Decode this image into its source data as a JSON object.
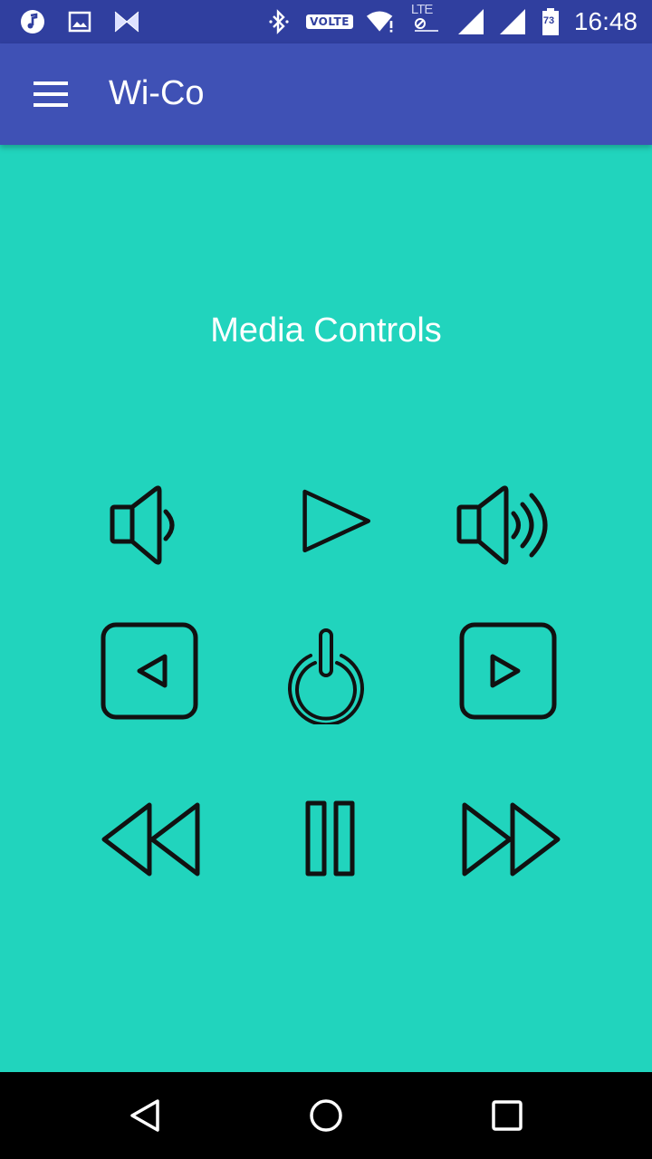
{
  "status_bar": {
    "left_icons": [
      "music-note-icon",
      "image-icon",
      "bowtie-icon"
    ],
    "right_icons": [
      "bluetooth-icon",
      "wifi-icon",
      "lte-icon",
      "signal-icon",
      "signal-icon",
      "battery-icon"
    ],
    "volte": "VOLTE",
    "lte": "LTE",
    "battery_level": "73",
    "time": "16:48"
  },
  "app_bar": {
    "title": "Wi-Co",
    "menu_icon": "hamburger-menu-icon",
    "color": "#3f51b5"
  },
  "main": {
    "title": "Media Controls",
    "background": "#21d4bd",
    "controls": [
      {
        "name": "volume-down-icon"
      },
      {
        "name": "play-icon"
      },
      {
        "name": "volume-up-icon"
      },
      {
        "name": "previous-icon"
      },
      {
        "name": "power-icon"
      },
      {
        "name": "next-icon"
      },
      {
        "name": "rewind-icon"
      },
      {
        "name": "pause-icon"
      },
      {
        "name": "fast-forward-icon"
      }
    ]
  },
  "nav_bar": {
    "buttons": [
      "back-icon",
      "home-icon",
      "recents-icon"
    ]
  }
}
